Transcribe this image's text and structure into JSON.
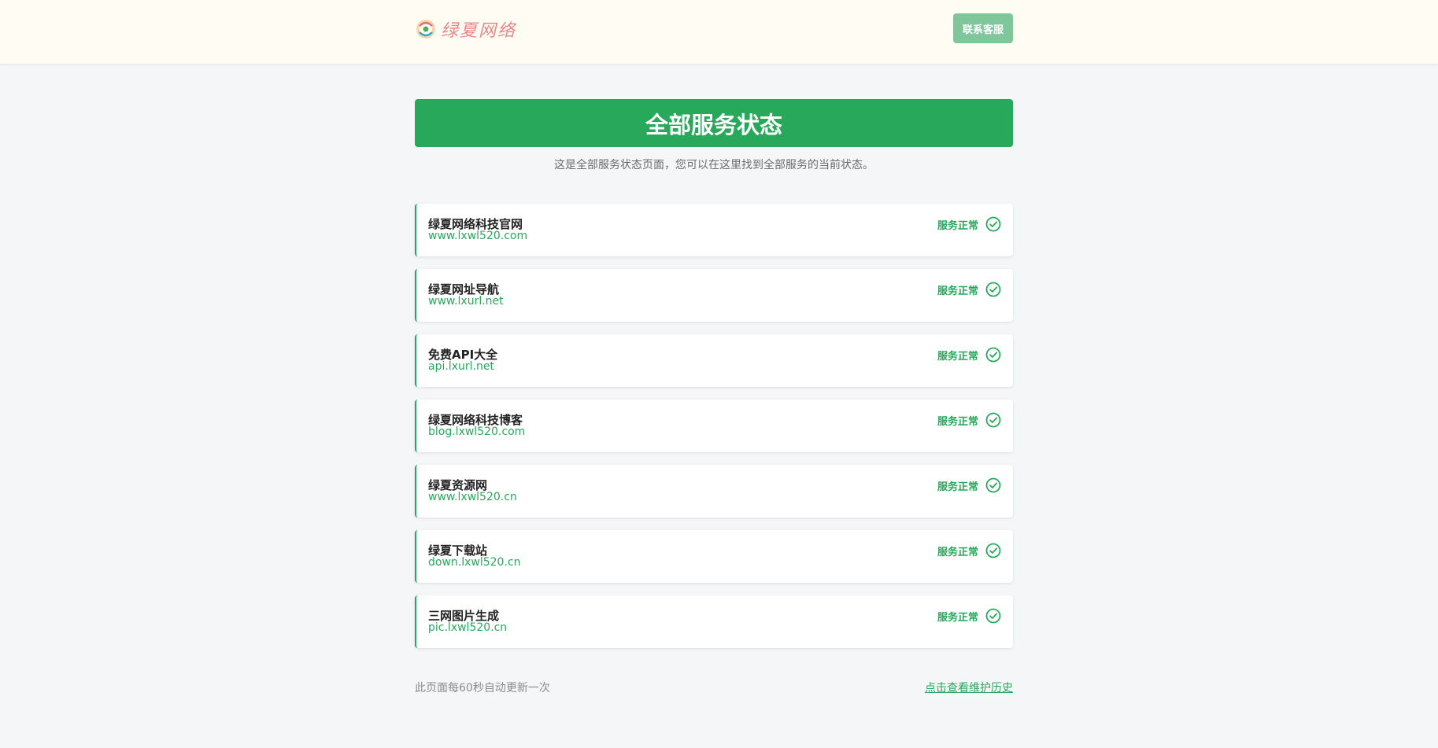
{
  "header": {
    "logo_text": "绿夏网络",
    "contact_label": "联系客服"
  },
  "banner": {
    "title": "全部服务状态"
  },
  "subtitle": "这是全部服务状态页面，您可以在这里找到全部服务的当前状态。",
  "services": [
    {
      "name": "绿夏网络科技官网",
      "url": "www.lxwl520.com",
      "status": "服务正常"
    },
    {
      "name": "绿夏网址导航",
      "url": "www.lxurl.net",
      "status": "服务正常"
    },
    {
      "name": "免费API大全",
      "url": "api.lxurl.net",
      "status": "服务正常"
    },
    {
      "name": "绿夏网络科技博客",
      "url": "blog.lxwl520.com",
      "status": "服务正常"
    },
    {
      "name": "绿夏资源网",
      "url": "www.lxwl520.cn",
      "status": "服务正常"
    },
    {
      "name": "绿夏下载站",
      "url": "down.lxwl520.cn",
      "status": "服务正常"
    },
    {
      "name": "三网图片生成",
      "url": "pic.lxwl520.cn",
      "status": "服务正常"
    }
  ],
  "footer": {
    "refresh_note": "此页面每60秒自动更新一次",
    "history_link": "点击查看维护历史"
  },
  "colors": {
    "accent": "#27a85a",
    "button": "#7fc79b",
    "header_bg": "#fefcf3",
    "page_bg": "#f5f6f8"
  }
}
